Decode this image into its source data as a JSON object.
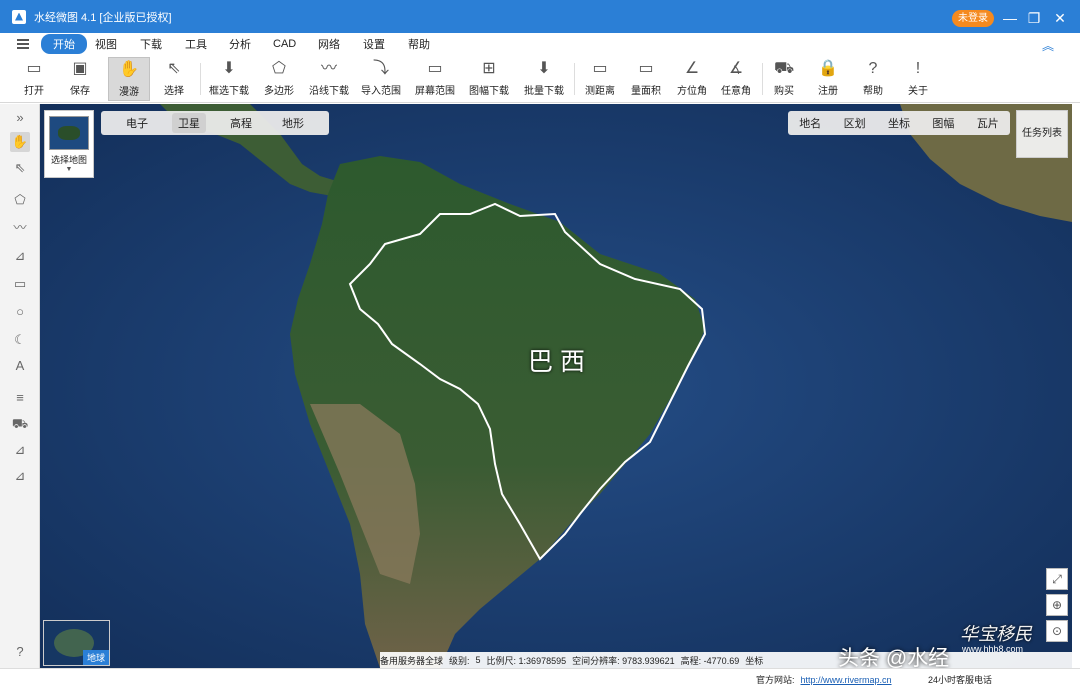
{
  "titlebar": {
    "title": "水经微图 4.1 [企业版已授权]",
    "login": "未登录",
    "min": "—",
    "restore": "❐",
    "close": "✕"
  },
  "menubar": {
    "items": [
      "开始",
      "视图",
      "下载",
      "工具",
      "分析",
      "CAD",
      "网络",
      "设置",
      "帮助"
    ],
    "collapse": "︽"
  },
  "toolbar": {
    "tools": [
      {
        "label": "打开",
        "icon": "▭"
      },
      {
        "label": "保存",
        "icon": "▣"
      },
      {
        "label": "漫游",
        "icon": "✋"
      },
      {
        "label": "选择",
        "icon": "⇖"
      },
      {
        "label": "框选下载",
        "icon": "⬇"
      },
      {
        "label": "多边形",
        "icon": "⬠"
      },
      {
        "label": "沿线下载",
        "icon": "〰"
      },
      {
        "label": "导入范围",
        "icon": "⤵"
      },
      {
        "label": "屏幕范围",
        "icon": "▭"
      },
      {
        "label": "图幅下载",
        "icon": "⊞"
      },
      {
        "label": "批量下载",
        "icon": "⬇"
      },
      {
        "label": "测距离",
        "icon": "▭"
      },
      {
        "label": "量面积",
        "icon": "▭"
      },
      {
        "label": "方位角",
        "icon": "∠"
      },
      {
        "label": "任意角",
        "icon": "∡"
      },
      {
        "label": "购买",
        "icon": "⛟"
      },
      {
        "label": "注册",
        "icon": "🔒"
      },
      {
        "label": "帮助",
        "icon": "?"
      },
      {
        "label": "关于",
        "icon": "!"
      }
    ]
  },
  "sidebar": {
    "icons": [
      "»",
      "✋",
      "⇖",
      "⬠",
      "〰",
      "⊿",
      "▭",
      "○",
      "☾",
      "A",
      "≡",
      "⛟",
      "⊿",
      "⊿",
      "?"
    ]
  },
  "map": {
    "layer_switch_label": "选择地图",
    "base_tabs": [
      "电子",
      "卫星",
      "高程",
      "地形"
    ],
    "active_base": "卫星",
    "tool_tabs": [
      "地名",
      "区划",
      "坐标",
      "图幅",
      "瓦片"
    ],
    "task_list": "任务列表",
    "region_label": "巴西",
    "overview_label": "地球",
    "zoom_icons": [
      "⤢",
      "⊕",
      "⊙"
    ]
  },
  "status": {
    "server": "备用服务器全球",
    "level_label": "级别:",
    "level": "5",
    "scale": "比例尺: 1:36978595",
    "resolution": "空间分辨率: 9783.939621",
    "elevation": "高程: -4770.69",
    "coord": "坐标"
  },
  "watermark": {
    "text": "头条 @水经",
    "brand": "华宝移民",
    "site": "www.hhb8.com"
  },
  "bottom": {
    "site_label": "官方网站:",
    "site_url": "http://www.rivermap.cn",
    "service": "24小时客服电话"
  },
  "colors": {
    "accent": "#2b7fd6",
    "login": "#f58a1f",
    "ocean": "#1b3d6e",
    "land": "#2e5230"
  }
}
